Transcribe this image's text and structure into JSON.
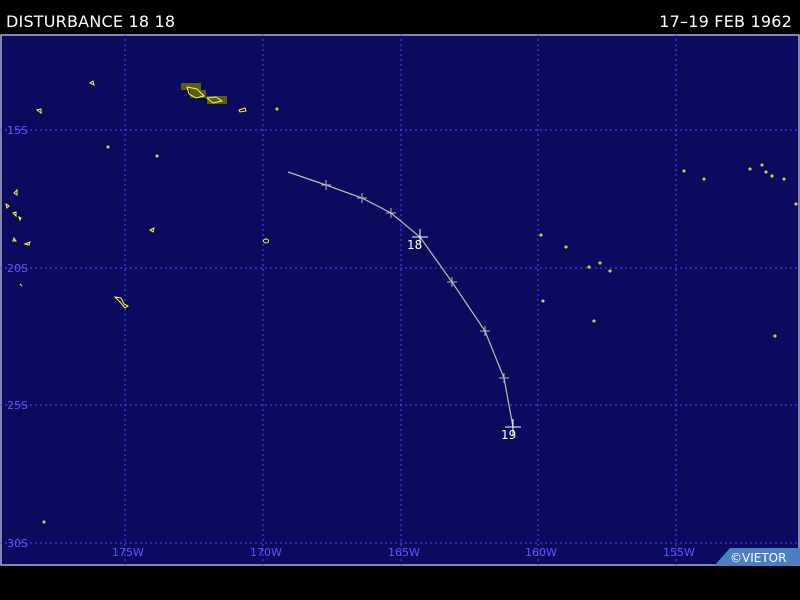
{
  "header": {
    "title": "DISTURBANCE 18 18",
    "dates": "17–19 FEB 1962"
  },
  "map": {
    "background": "#0a0a5e",
    "grid_color": "#4d4dff",
    "land_color": "#ffff33",
    "track_color": "#bbbbbb",
    "lon_labels": [
      "175W",
      "170W",
      "165W",
      "160W",
      "155W"
    ],
    "lat_labels": [
      "15S",
      "20S",
      "25S",
      "30S"
    ],
    "credit": "©VIETOR"
  },
  "track": {
    "day_labels": [
      "18",
      "19"
    ]
  }
}
